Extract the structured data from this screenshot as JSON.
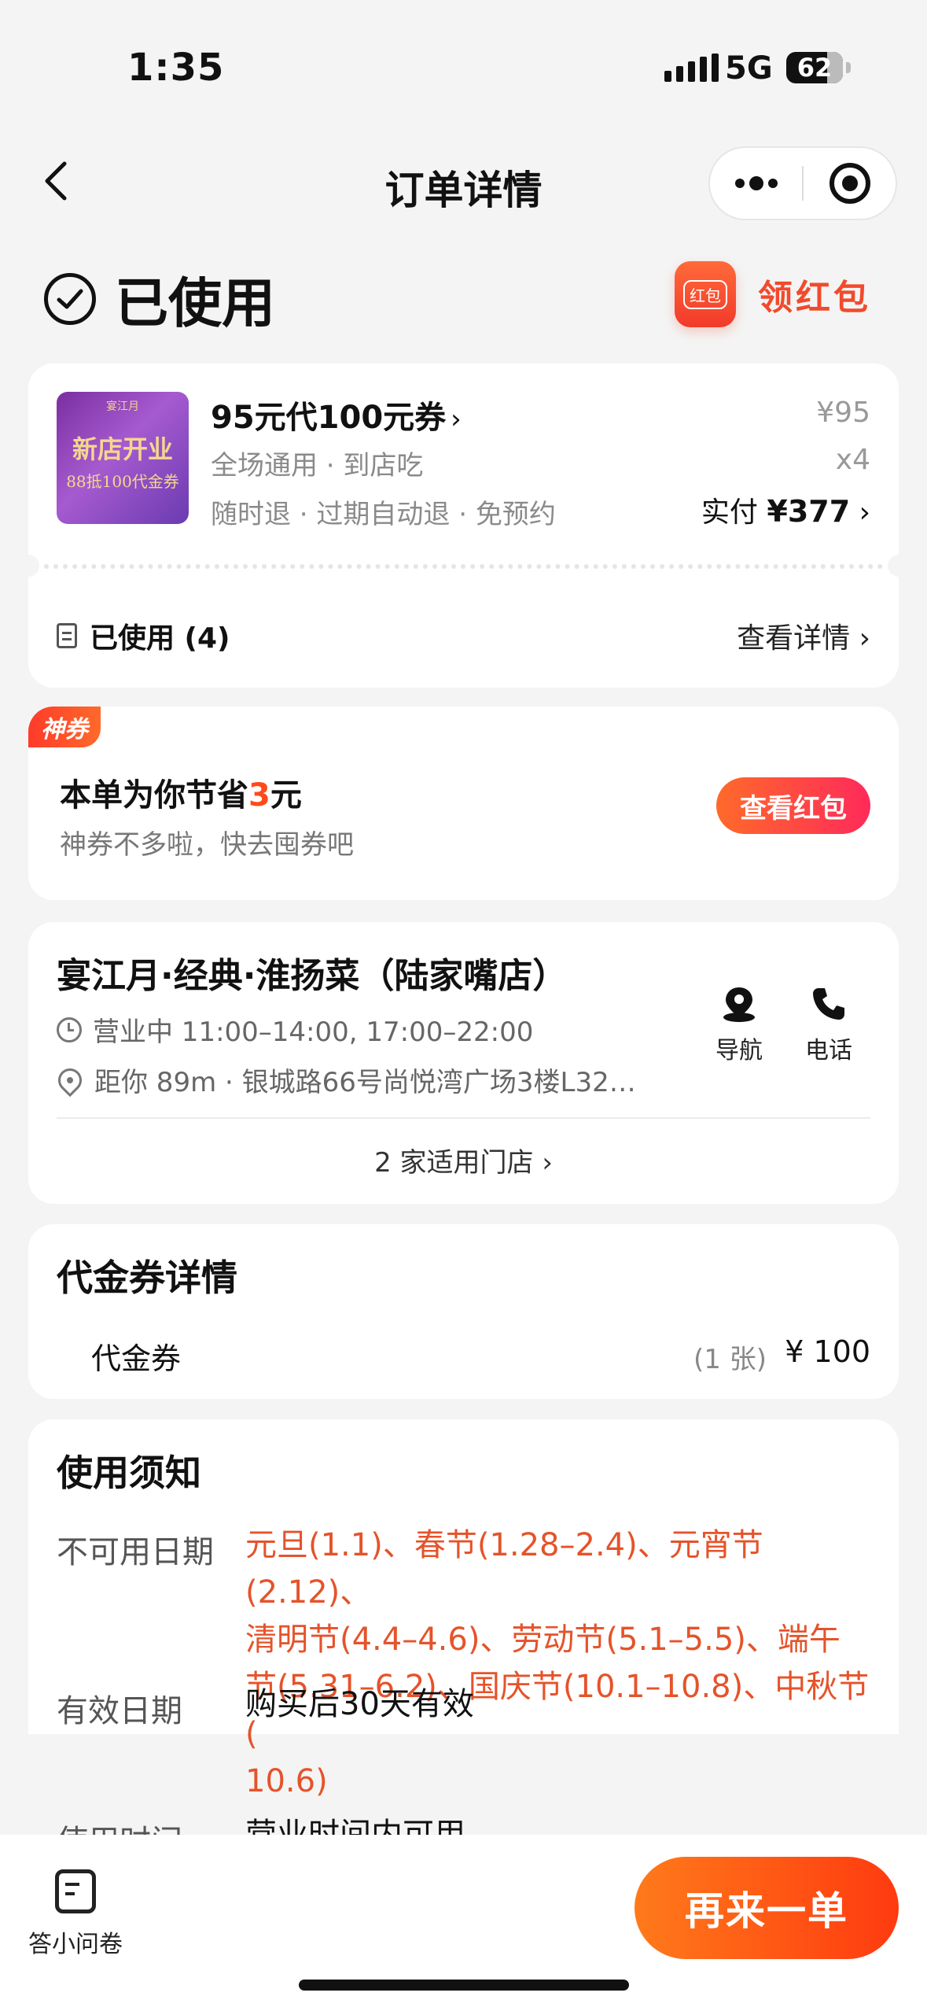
{
  "status_bar": {
    "time": "1:35",
    "network": "5G",
    "battery": "62"
  },
  "nav": {
    "title": "订单详情"
  },
  "order_status": {
    "label": "已使用",
    "red_packet_icon": "红包",
    "red_packet_label": "领红包"
  },
  "product": {
    "thumb_brand": "宴江月",
    "thumb_line1": "新店开业",
    "thumb_line2": "88抵100代金券",
    "title": "95元代100元券",
    "sub1": "全场通用 · 到店吃",
    "sub2": "随时退 · 过期自动退 · 免预约",
    "unit_price": "¥95",
    "quantity": "x4",
    "paid_label": "实付",
    "paid_value": "¥377",
    "used_label": "已使用 (4)",
    "detail_link": "查看详情"
  },
  "coupon": {
    "badge": "神券",
    "save_prefix": "本单为你节省",
    "save_amount": "3",
    "save_suffix": "元",
    "sub": "神券不多啦，快去囤券吧",
    "button": "查看红包"
  },
  "shop": {
    "name": "宴江月·经典·淮扬菜（陆家嘴店）",
    "hours": "营业中 11:00–14:00, 17:00–22:00",
    "address": "距你 89m ·  银城路66号尚悦湾广场3楼L32…",
    "nav_label": "导航",
    "phone_label": "电话",
    "stores_link": "2 家适用门店"
  },
  "voucher": {
    "section_title": "代金券详情",
    "name": "代金券",
    "count": "(1 张)",
    "price": "¥ 100"
  },
  "rules": {
    "section_title": "使用须知",
    "unavailable_label": "不可用日期",
    "unavailable_lines": [
      "元旦(1.1)、春节(1.28–2.4)、元宵节(2.12)、",
      "清明节(4.4–4.6)、劳动节(5.1–5.5)、端午",
      "节(5.31–6.2)、国庆节(10.1–10.8)、中秋节(",
      "10.6)"
    ],
    "valid_label": "有效日期",
    "valid_value": "购买后30天有效",
    "time_label": "使用时间",
    "time_value": "营业时间内可用"
  },
  "bottom": {
    "survey_label": "答小问卷",
    "reorder_button": "再来一单"
  },
  "colors": {
    "accent": "#ff4a1a",
    "rule_red": "#e5532a",
    "button_orange": "#ff5a14"
  }
}
